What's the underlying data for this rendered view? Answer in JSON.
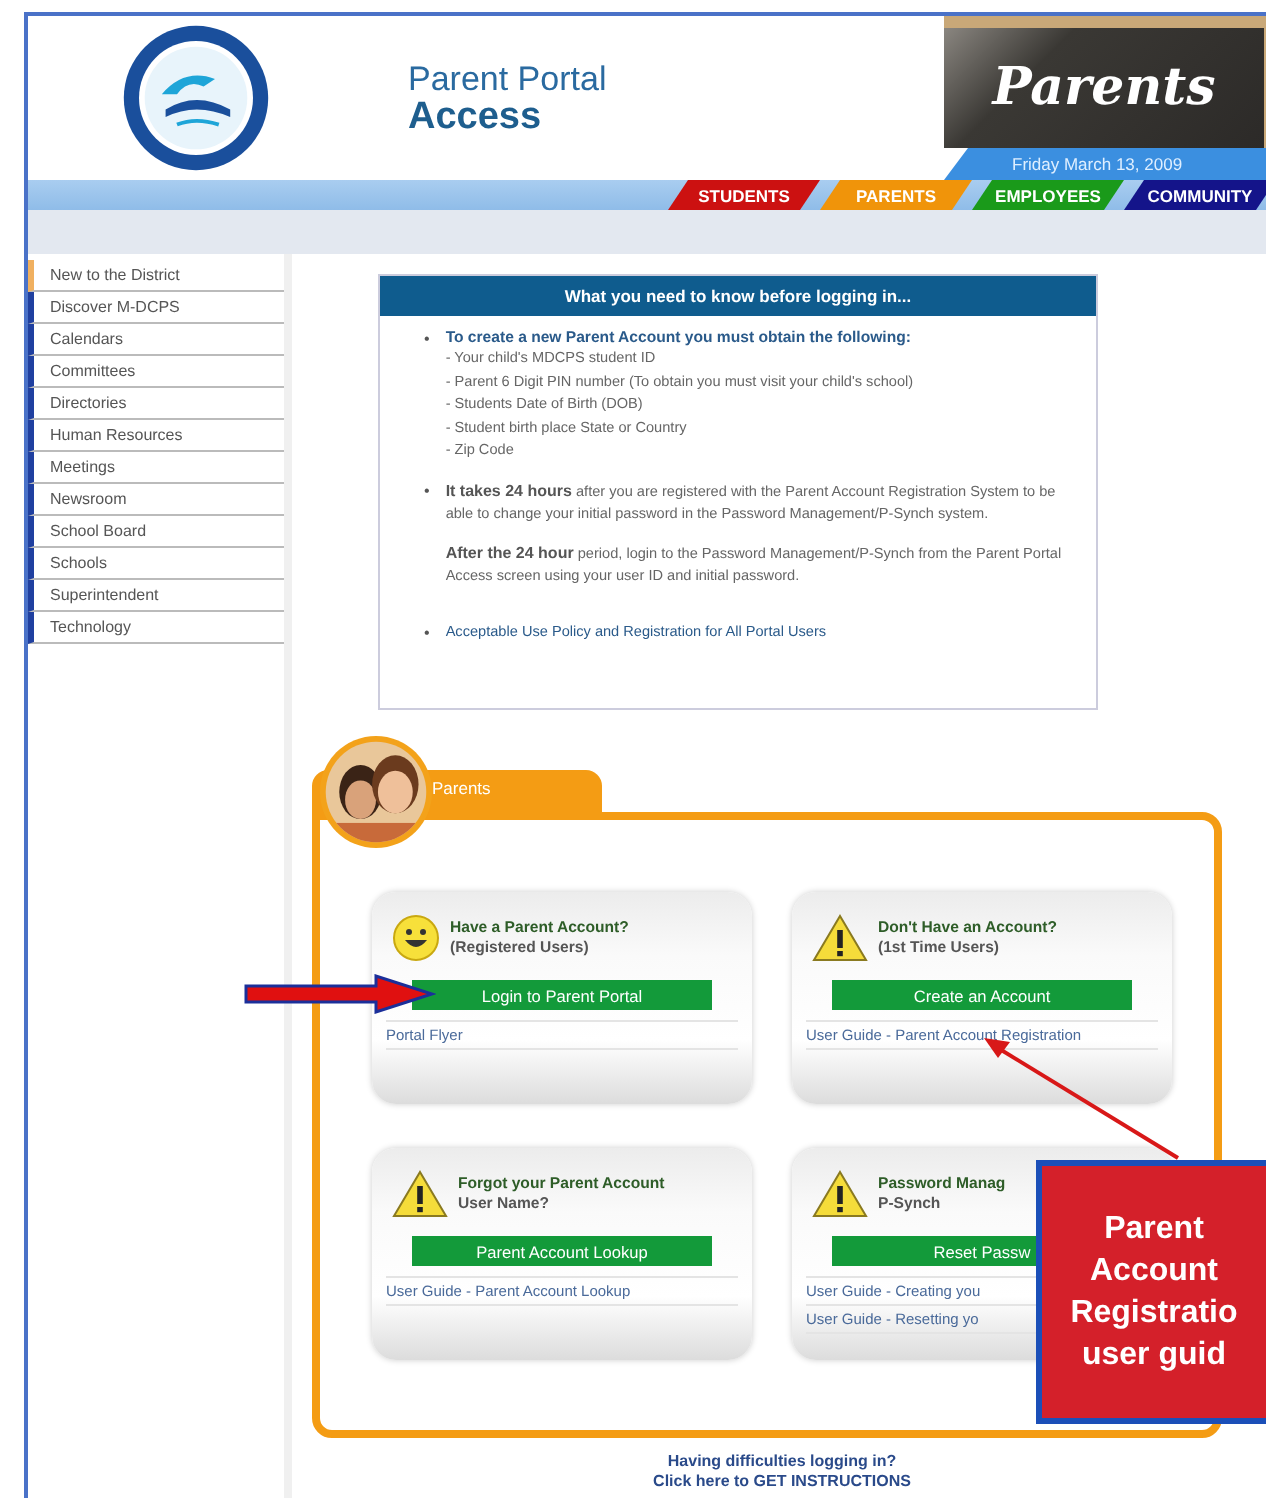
{
  "header": {
    "title_line1": "Parent Portal",
    "title_line2": "Access",
    "banner": "Parents",
    "date": "Friday March 13, 2009"
  },
  "nav_tabs": [
    {
      "label": "STUDENTS",
      "color": "#cc1111"
    },
    {
      "label": "PARENTS",
      "color": "#f0940a"
    },
    {
      "label": "EMPLOYEES",
      "color": "#1a9a1a"
    },
    {
      "label": "COMMUNITY",
      "color": "#14148a"
    }
  ],
  "sidebar": {
    "items": [
      {
        "label": "New to the District",
        "selected": true
      },
      {
        "label": "Discover M-DCPS",
        "selected": false
      },
      {
        "label": "Calendars",
        "selected": false
      },
      {
        "label": "Committees",
        "selected": false
      },
      {
        "label": "Directories",
        "selected": false
      },
      {
        "label": "Human Resources",
        "selected": false
      },
      {
        "label": "Meetings",
        "selected": false
      },
      {
        "label": "Newsroom",
        "selected": false
      },
      {
        "label": "School Board",
        "selected": false
      },
      {
        "label": "Schools",
        "selected": false
      },
      {
        "label": "Superintendent",
        "selected": false
      },
      {
        "label": "Technology",
        "selected": false
      }
    ]
  },
  "info_box": {
    "title": "What you need to know before logging in...",
    "bullets": [
      {
        "kind": "list",
        "marker": "•",
        "heading": "To create a new Parent Account you must obtain the following:",
        "lines": [
          "- Your child's MDCPS student ID",
          "- Parent 6 Digit PIN number (To obtain you must visit your child's school)",
          "- Students Date of Birth (DOB)",
          "- Student birth place State or Country",
          "- Zip Code"
        ]
      },
      {
        "kind": "paragraphs",
        "marker": "•",
        "paragraphs": [
          "**It takes 24 hours** after you are registered with the Parent Account Registration System to be able to change your initial password in the Password Management/P-Synch system.",
          "**After the 24 hour** period, login to the Password Management/P-Synch from the Parent Portal Access screen using your user ID and initial password."
        ]
      },
      {
        "kind": "link",
        "marker": "•",
        "text": "Acceptable Use Policy and Registration for All Portal Users"
      }
    ]
  },
  "parents_panel": {
    "tab": "Parents",
    "cards": [
      {
        "kind": "smiley",
        "title_lines": [
          "Have a Parent Account?",
          "(Registered Users)"
        ],
        "button": "Login to Parent Portal",
        "links": [
          "Portal Flyer"
        ]
      },
      {
        "kind": "warning",
        "title_lines": [
          "Don't Have an Account?",
          "(1st Time Users)"
        ],
        "button": "Create an Account",
        "links": [
          "User Guide - Parent Account Registration"
        ]
      },
      {
        "kind": "warning",
        "title_lines": [
          "Forgot your Parent Account",
          "User Name?"
        ],
        "button": "Parent Account Lookup",
        "links": [
          "User Guide - Parent Account Lookup"
        ]
      },
      {
        "kind": "warning",
        "title_lines": [
          "Password Manag",
          "P-Synch"
        ],
        "button": "Reset Passw",
        "links": [
          "User Guide - Creating you",
          "User Guide - Resetting yo"
        ]
      }
    ]
  },
  "footer": {
    "line1": "Having difficulties logging in?",
    "line2": "Click here to GET INSTRUCTIONS"
  },
  "callout": {
    "lines": [
      "Parent",
      "Account",
      "Registratio",
      "user guid"
    ]
  }
}
